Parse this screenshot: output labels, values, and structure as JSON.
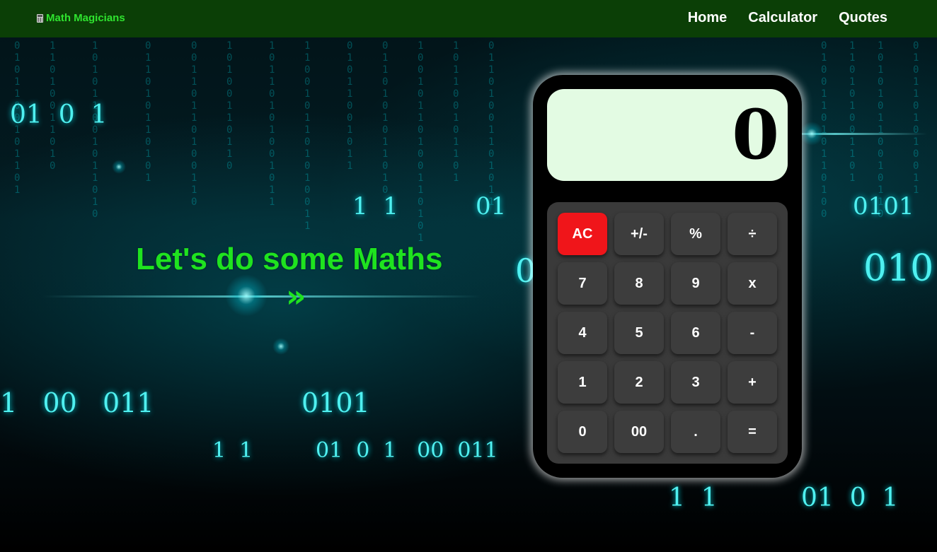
{
  "navbar": {
    "brand": "Math Magicians",
    "links": [
      "Home",
      "Calculator",
      "Quotes"
    ]
  },
  "hero": {
    "title": "Let's do some Maths",
    "arrow": "»"
  },
  "calculator": {
    "display": "0",
    "keys": [
      [
        "AC",
        "+/-",
        "%",
        "÷"
      ],
      [
        "7",
        "8",
        "9",
        "x"
      ],
      [
        "4",
        "5",
        "6",
        "-"
      ],
      [
        "1",
        "2",
        "3",
        "+"
      ],
      [
        "0",
        "00",
        ".",
        "="
      ]
    ]
  },
  "background_bits": [
    "01  0  1",
    "1  1",
    "01",
    "0101",
    "010",
    "1   00   011",
    "0101",
    "1  1",
    "01  0  1   00  011",
    "1  1",
    "01  0  1",
    "0"
  ],
  "colors": {
    "navbar": "#0b3f06",
    "brand": "#2fe32f",
    "hero_text": "#1fe31f",
    "display_bg": "#e3fbe3",
    "keypad_bg": "#3a3a3a",
    "key_bg": "#3d3d3d",
    "clear_key": "#f0151a"
  }
}
